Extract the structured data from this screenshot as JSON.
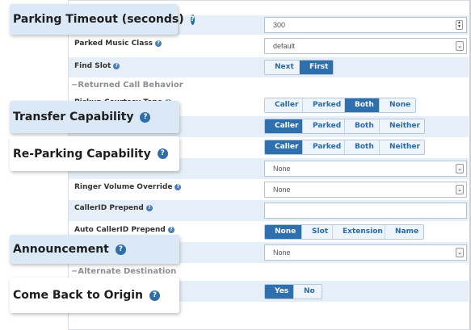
{
  "fields": {
    "parking_timeout": {
      "label": "Parking Timeout (seconds)",
      "value": "300"
    },
    "parked_music_class": {
      "label": "Parked Music Class",
      "value": "default"
    },
    "find_slot": {
      "label": "Find Slot",
      "options": [
        "Next",
        "First"
      ],
      "selected": "First"
    },
    "pickup_courtesy_tone": {
      "label": "Pickup Courtesy Tone",
      "options": [
        "Caller",
        "Parked",
        "Both",
        "None"
      ],
      "selected": "Both"
    },
    "transfer_capability": {
      "label": "Transfer Capability",
      "options": [
        "Caller",
        "Parked",
        "Both",
        "Neither"
      ],
      "selected": "Caller"
    },
    "reparking_capability": {
      "label": "Re-Parking Capability",
      "options": [
        "Caller",
        "Parked",
        "Both",
        "Neither"
      ],
      "selected": "Caller"
    },
    "alert_info": {
      "value": "None"
    },
    "ringer_volume_override": {
      "label": "Ringer Volume Override",
      "value": "None"
    },
    "callerid_prepend": {
      "label": "CallerID Prepend",
      "value": ""
    },
    "auto_callerid_prepend": {
      "label": "Auto CallerID Prepend",
      "options": [
        "None",
        "Slot",
        "Extension",
        "Name"
      ],
      "selected": "None"
    },
    "announcement": {
      "label": "Announcement",
      "value": "None"
    },
    "come_back_to_origin": {
      "label": "Come Back to Origin",
      "options": [
        "Yes",
        "No"
      ],
      "selected": "Yes"
    }
  },
  "sections": {
    "returned_call_behavior": "Returned Call Behavior",
    "alternate_destination": "Alternate Destination"
  },
  "colors": {
    "accent": "#2f6fae",
    "row_shade": "#e6eff7",
    "callout_bg": "#dbe8f5"
  },
  "icons": {
    "help": "help-icon",
    "spinner": "spinner-icon",
    "dropdown": "chevron-down-icon"
  }
}
